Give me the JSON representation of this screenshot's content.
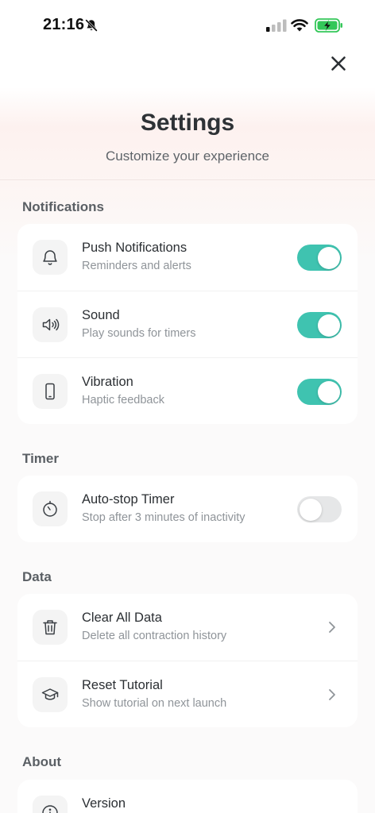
{
  "status_bar": {
    "time": "21:16",
    "icons": [
      "bell-off-icon",
      "cellular-signal-icon",
      "wifi-icon",
      "battery-charging-icon"
    ]
  },
  "header": {
    "title": "Settings",
    "subtitle": "Customize your experience"
  },
  "colors": {
    "accent": "#3fc3b0",
    "toggle_off": "#e6e7e8",
    "battery": "#34c759"
  },
  "sections": {
    "notifications": {
      "label": "Notifications",
      "items": [
        {
          "icon": "bell-icon",
          "title": "Push Notifications",
          "subtitle": "Reminders and alerts",
          "enabled": true
        },
        {
          "icon": "speaker-icon",
          "title": "Sound",
          "subtitle": "Play sounds for timers",
          "enabled": true
        },
        {
          "icon": "phone-icon",
          "title": "Vibration",
          "subtitle": "Haptic feedback",
          "enabled": true
        }
      ]
    },
    "timer": {
      "label": "Timer",
      "items": [
        {
          "icon": "timer-icon",
          "title": "Auto-stop Timer",
          "subtitle": "Stop after 3 minutes of inactivity",
          "enabled": false
        }
      ]
    },
    "data": {
      "label": "Data",
      "items": [
        {
          "icon": "trash-icon",
          "title": "Clear All Data",
          "subtitle": "Delete all contraction history"
        },
        {
          "icon": "graduation-cap-icon",
          "title": "Reset Tutorial",
          "subtitle": "Show tutorial on next launch"
        }
      ]
    },
    "about": {
      "label": "About",
      "items": [
        {
          "icon": "info-icon",
          "title": "Version"
        }
      ]
    }
  }
}
